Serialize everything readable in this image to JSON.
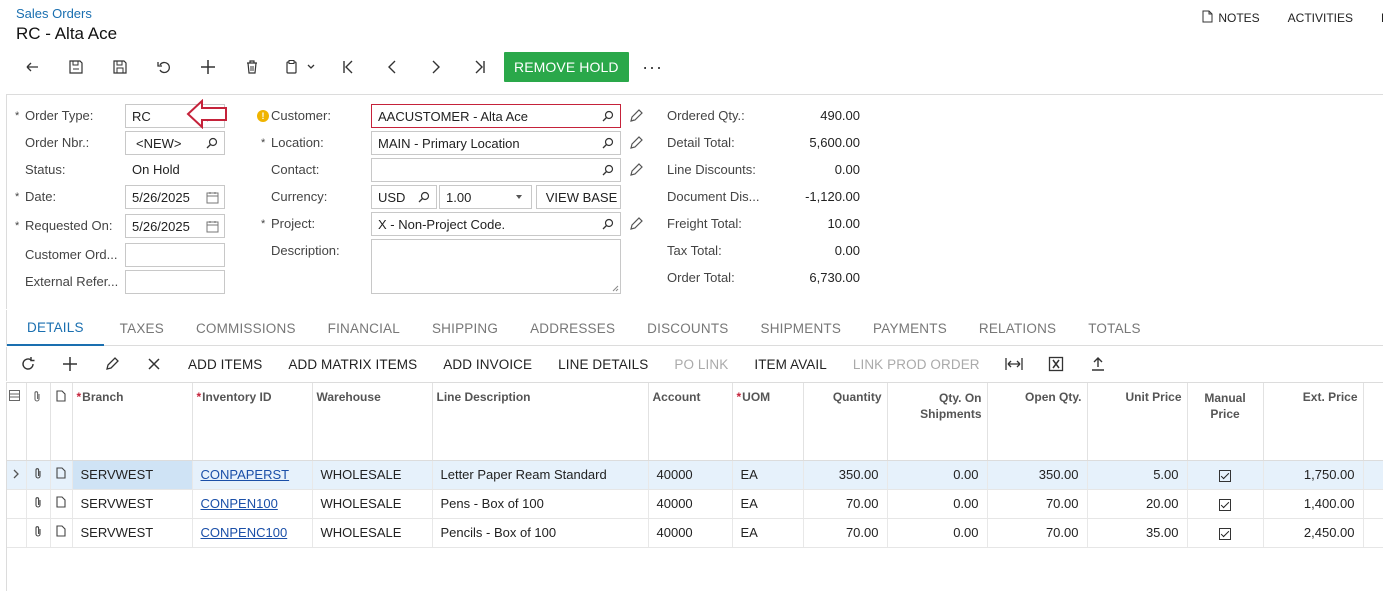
{
  "header": {
    "breadcrumb": "Sales Orders",
    "title": "RC - Alta Ace",
    "links": [
      "NOTES",
      "ACTIVITIES",
      "FI"
    ]
  },
  "toolbar": {
    "remove_hold": "REMOVE HOLD",
    "more": "···"
  },
  "form": {
    "order_type": {
      "label": "Order Type:",
      "value": "RC"
    },
    "order_nbr": {
      "label": "Order Nbr.:",
      "value": "<NEW>"
    },
    "status": {
      "label": "Status:",
      "value": "On Hold"
    },
    "date": {
      "label": "Date:",
      "value": "5/26/2025"
    },
    "requested_on": {
      "label": "Requested On:",
      "value": "5/26/2025"
    },
    "customer_ord": {
      "label": "Customer Ord...",
      "value": ""
    },
    "external_ref": {
      "label": "External Refer...",
      "value": ""
    },
    "customer": {
      "label": "Customer:",
      "value": "AACUSTOMER - Alta Ace"
    },
    "location": {
      "label": "Location:",
      "value": "MAIN - Primary Location"
    },
    "contact": {
      "label": "Contact:",
      "value": ""
    },
    "currency": {
      "label": "Currency:",
      "value": "USD",
      "rate": "1.00",
      "view_base": "VIEW BASE"
    },
    "project": {
      "label": "Project:",
      "value": "X - Non-Project Code."
    },
    "description": {
      "label": "Description:",
      "value": ""
    }
  },
  "totals": {
    "ordered_qty": {
      "label": "Ordered Qty.:",
      "value": "490.00"
    },
    "detail_total": {
      "label": "Detail Total:",
      "value": "5,600.00"
    },
    "line_discounts": {
      "label": "Line Discounts:",
      "value": "0.00"
    },
    "document_dis": {
      "label": "Document Dis...",
      "value": "-1,120.00"
    },
    "freight_total": {
      "label": "Freight Total:",
      "value": "10.00"
    },
    "tax_total": {
      "label": "Tax Total:",
      "value": "0.00"
    },
    "order_total": {
      "label": "Order Total:",
      "value": "6,730.00"
    }
  },
  "tabs": [
    "DETAILS",
    "TAXES",
    "COMMISSIONS",
    "FINANCIAL",
    "SHIPPING",
    "ADDRESSES",
    "DISCOUNTS",
    "SHIPMENTS",
    "PAYMENTS",
    "RELATIONS",
    "TOTALS"
  ],
  "grid_toolbar": {
    "add_items": "ADD ITEMS",
    "add_matrix_items": "ADD MATRIX ITEMS",
    "add_invoice": "ADD INVOICE",
    "line_details": "LINE DETAILS",
    "po_link": "PO LINK",
    "item_avail": "ITEM AVAIL",
    "link_prod_order": "LINK PROD ORDER"
  },
  "columns": {
    "branch": "Branch",
    "inventory_id": "Inventory ID",
    "warehouse": "Warehouse",
    "line_description": "Line Description",
    "account": "Account",
    "uom": "UOM",
    "quantity": "Quantity",
    "qty_on_shipments": "Qty. On Shipments",
    "open_qty": "Open Qty.",
    "unit_price": "Unit Price",
    "manual_price": "Manual Price",
    "ext_price": "Ext. Price"
  },
  "rows": [
    {
      "branch": "SERVWEST",
      "inventory_id": "CONPAPERST",
      "warehouse": "WHOLESALE",
      "description": "Letter Paper Ream Standard",
      "account": "40000",
      "uom": "EA",
      "quantity": "350.00",
      "qty_on_shipments": "0.00",
      "open_qty": "350.00",
      "unit_price": "5.00",
      "manual_price": true,
      "ext_price": "1,750.00"
    },
    {
      "branch": "SERVWEST",
      "inventory_id": "CONPEN100",
      "warehouse": "WHOLESALE",
      "description": "Pens - Box of 100",
      "account": "40000",
      "uom": "EA",
      "quantity": "70.00",
      "qty_on_shipments": "0.00",
      "open_qty": "70.00",
      "unit_price": "20.00",
      "manual_price": true,
      "ext_price": "1,400.00"
    },
    {
      "branch": "SERVWEST",
      "inventory_id": "CONPENC100",
      "warehouse": "WHOLESALE",
      "description": "Pencils - Box of 100",
      "account": "40000",
      "uom": "EA",
      "quantity": "70.00",
      "qty_on_shipments": "0.00",
      "open_qty": "70.00",
      "unit_price": "35.00",
      "manual_price": true,
      "ext_price": "2,450.00"
    }
  ],
  "colors": {
    "accent": "#1a6fb0",
    "primary_button": "#2aa84a",
    "error": "#c5223a",
    "callout": "#c5223a"
  }
}
